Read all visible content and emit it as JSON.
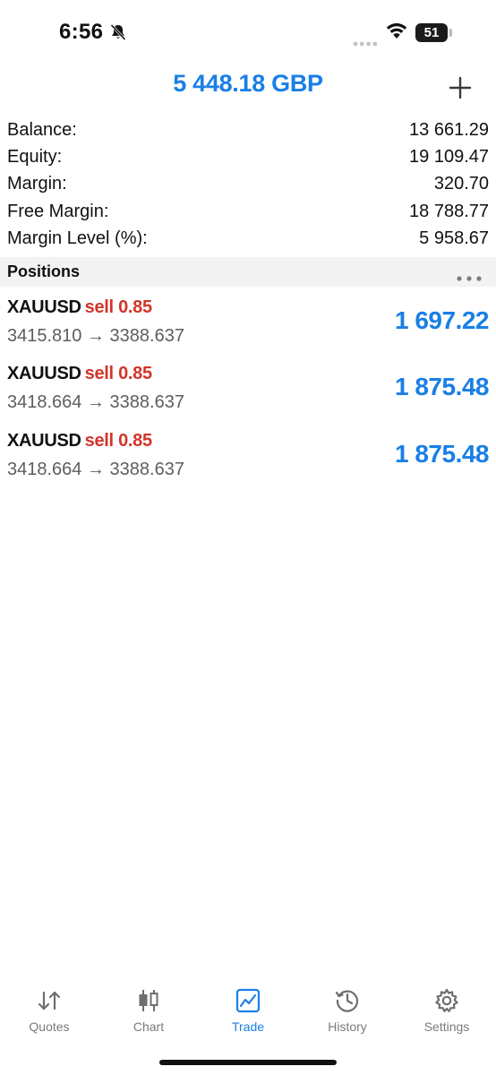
{
  "status_bar": {
    "time": "6:56",
    "battery": "51",
    "icons": [
      "bell-slash-icon",
      "signal-dots-icon",
      "wifi-icon",
      "battery-icon"
    ]
  },
  "header": {
    "title": "5 448.18 GBP",
    "add_icon": "plus-icon"
  },
  "summary": [
    {
      "label": "Balance:",
      "value": "13 661.29"
    },
    {
      "label": "Equity:",
      "value": "19 109.47"
    },
    {
      "label": "Margin:",
      "value": "320.70"
    },
    {
      "label": "Free Margin:",
      "value": "18 788.77"
    },
    {
      "label": "Margin Level (%):",
      "value": "5 958.67"
    }
  ],
  "positions": {
    "title": "Positions",
    "items": [
      {
        "symbol": "XAUUSD",
        "side": "sell 0.85",
        "prices": "3415.810 → 3388.637",
        "profit": "1 697.22"
      },
      {
        "symbol": "XAUUSD",
        "side": "sell 0.85",
        "prices": "3418.664 → 3388.637",
        "profit": "1 875.48"
      },
      {
        "symbol": "XAUUSD",
        "side": "sell 0.85",
        "prices": "3418.664 → 3388.637",
        "profit": "1 875.48"
      }
    ]
  },
  "tabs": [
    {
      "label": "Quotes",
      "icon": "quotes-arrows-icon",
      "active": false
    },
    {
      "label": "Chart",
      "icon": "candlestick-icon",
      "active": false
    },
    {
      "label": "Trade",
      "icon": "trade-chart-icon",
      "active": true
    },
    {
      "label": "History",
      "icon": "history-clock-icon",
      "active": false
    },
    {
      "label": "Settings",
      "icon": "gear-icon",
      "active": false
    }
  ],
  "colors": {
    "accent": "#1a7fe5",
    "sell": "#d2352a",
    "section_bg": "#f3f3f3"
  }
}
